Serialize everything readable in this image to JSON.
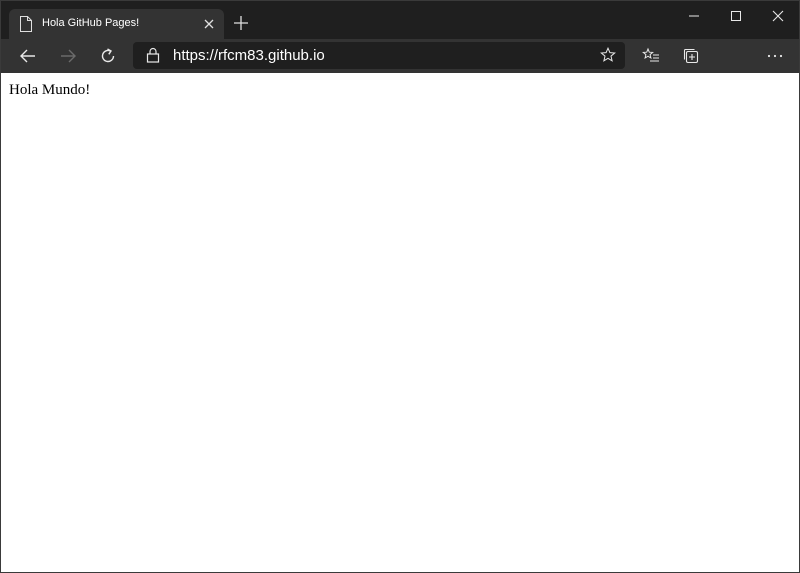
{
  "tab": {
    "title": "Hola GitHub Pages!"
  },
  "address": {
    "url": "https://rfcm83.github.io"
  },
  "page": {
    "body_text": "Hola Mundo!"
  },
  "icons": {
    "tab_page": "page-icon",
    "tab_close": "close-icon",
    "new_tab": "plus-icon",
    "minimize": "minimize-icon",
    "maximize": "maximize-icon",
    "close_window": "close-icon",
    "back": "back-arrow-icon",
    "forward": "forward-arrow-icon",
    "refresh": "refresh-icon",
    "lock": "lock-icon",
    "favorite": "star-icon",
    "favorites": "favorites-icon",
    "collections": "collections-icon",
    "menu": "more-icon"
  },
  "colors": {
    "chrome_dark": "#1f1f1f",
    "toolbar": "#333333",
    "page_background": "#ffffff"
  }
}
